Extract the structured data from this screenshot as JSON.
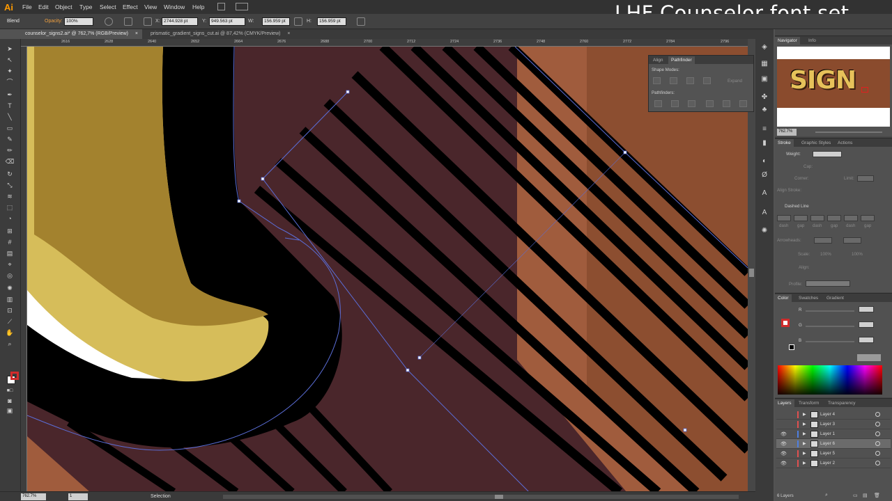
{
  "app": {
    "logo": "Ai",
    "overlay_title": "LHF Counselor font set",
    "menu": [
      "File",
      "Edit",
      "Object",
      "Type",
      "Select",
      "Effect",
      "View",
      "Window",
      "Help"
    ]
  },
  "control_bar": {
    "object_type": "Blend",
    "opacity_label": "Opacity:",
    "opacity_value": "100%",
    "x_label": "X:",
    "x_value": "2744.928 pt",
    "y_label": "Y:",
    "y_value": "949.563 pt",
    "w_label": "W:",
    "w_value": "156.959 pt",
    "h_label": "H:",
    "h_value": "156.959 pt"
  },
  "tabs": [
    {
      "label": "counselor_signs2.ai* @ 762,7% (RGB/Preview)",
      "close": "×"
    },
    {
      "label": "prismatic_gradient_signs_cut.ai @ 87,42% (CMYK/Preview)",
      "close": "×"
    }
  ],
  "ruler": {
    "h_ticks": [
      "2616",
      "2628",
      "2640",
      "2652",
      "2664",
      "2676",
      "2688",
      "2700",
      "2712",
      "2724",
      "2736",
      "2748",
      "2760",
      "2772",
      "2784",
      "2796"
    ]
  },
  "status": {
    "zoom": "762.7%",
    "page": "1",
    "tool": "Selection"
  },
  "navigator": {
    "tabs": [
      "Navigator",
      "Info"
    ],
    "preview_text": "SIGN",
    "zoom": "762.7%"
  },
  "stroke_panel": {
    "tabs": [
      "Stroke",
      "Graphic Styles",
      "Actions"
    ],
    "weight_label": "Weight:",
    "cap_label": "Cap:",
    "corner_label": "Corner:",
    "limit_label": "Limit:",
    "align_label": "Align Stroke:",
    "dashed_label": "Dashed Line",
    "dash_labels": [
      "dash",
      "gap",
      "dash",
      "gap",
      "dash",
      "gap"
    ],
    "arrowheads_label": "Arrowheads:",
    "scale_label": "Scale:",
    "scale_value1": "100%",
    "scale_value2": "100%",
    "align2_label": "Align:",
    "profile_label": "Profile:"
  },
  "color_panel": {
    "tabs": [
      "Color",
      "Swatches",
      "Gradient"
    ],
    "channels": [
      "R",
      "G",
      "B"
    ]
  },
  "layers_panel": {
    "tabs": [
      "Layers",
      "Transform",
      "Transparency"
    ],
    "layers": [
      {
        "name": "Layer 4",
        "color": "#e05050",
        "visible": false,
        "selected": false
      },
      {
        "name": "Layer 3",
        "color": "#e05050",
        "visible": false,
        "selected": false
      },
      {
        "name": "Layer 1",
        "color": "#4f7fe0",
        "visible": true,
        "selected": false
      },
      {
        "name": "Layer 6",
        "color": "#4f7fe0",
        "visible": true,
        "selected": true
      },
      {
        "name": "Layer 5",
        "color": "#e05050",
        "visible": true,
        "selected": false
      },
      {
        "name": "Layer 2",
        "color": "#e05050",
        "visible": true,
        "selected": false
      }
    ],
    "count": "6 Layers"
  },
  "pathfinder": {
    "tabs": [
      "Align",
      "Pathfinder"
    ],
    "shape_modes_label": "Shape Modes:",
    "expand_label": "Expand",
    "pathfinders_label": "Pathfinders:"
  },
  "colors": {
    "canvas_bg": "#4a262b",
    "copper": "#a05c3d",
    "copper_dark": "#8c4e30",
    "gold": "#d6bd5a",
    "gold_dark": "#a3822e",
    "selection_blue": "#5b6ed8"
  }
}
